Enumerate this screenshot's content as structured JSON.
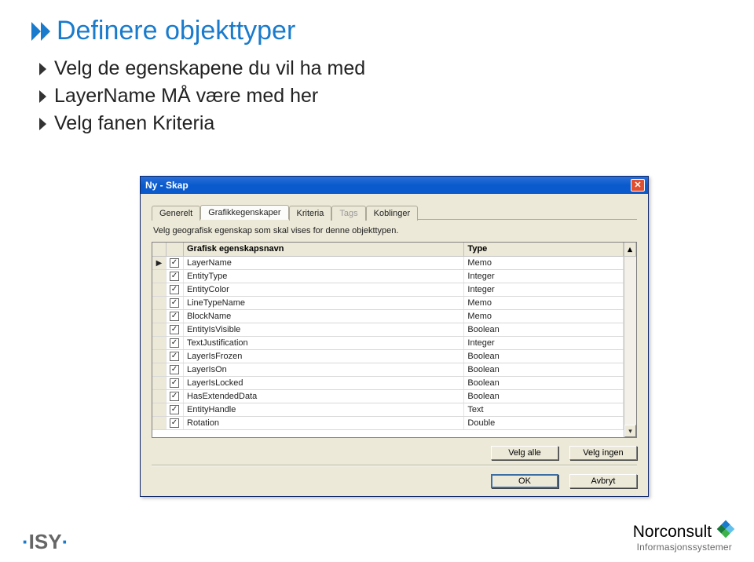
{
  "slide": {
    "title": "Definere objekttyper",
    "bullets": [
      "Velg de egenskapene du vil ha med",
      "LayerName MÅ være med her",
      "Velg fanen Kriteria"
    ]
  },
  "dialog": {
    "title": "Ny - Skap",
    "tabs": [
      {
        "label": "Generelt",
        "state": "normal"
      },
      {
        "label": "Grafikkegenskaper",
        "state": "active"
      },
      {
        "label": "Kriteria",
        "state": "normal"
      },
      {
        "label": "Tags",
        "state": "disabled"
      },
      {
        "label": "Koblinger",
        "state": "normal"
      }
    ],
    "instruction": "Velg geografisk egenskap som skal vises for denne objekttypen.",
    "grid": {
      "header_name": "Grafisk egenskapsnavn",
      "header_type": "Type",
      "rows": [
        {
          "mark": "▶",
          "checked": true,
          "name": "LayerName",
          "type": "Memo"
        },
        {
          "mark": "",
          "checked": true,
          "name": "EntityType",
          "type": "Integer"
        },
        {
          "mark": "",
          "checked": true,
          "name": "EntityColor",
          "type": "Integer"
        },
        {
          "mark": "",
          "checked": true,
          "name": "LineTypeName",
          "type": "Memo"
        },
        {
          "mark": "",
          "checked": true,
          "name": "BlockName",
          "type": "Memo"
        },
        {
          "mark": "",
          "checked": true,
          "name": "EntityIsVisible",
          "type": "Boolean"
        },
        {
          "mark": "",
          "checked": true,
          "name": "TextJustification",
          "type": "Integer"
        },
        {
          "mark": "",
          "checked": true,
          "name": "LayerIsFrozen",
          "type": "Boolean"
        },
        {
          "mark": "",
          "checked": true,
          "name": "LayerIsOn",
          "type": "Boolean"
        },
        {
          "mark": "",
          "checked": true,
          "name": "LayerIsLocked",
          "type": "Boolean"
        },
        {
          "mark": "",
          "checked": true,
          "name": "HasExtendedData",
          "type": "Boolean"
        },
        {
          "mark": "",
          "checked": true,
          "name": "EntityHandle",
          "type": "Text"
        },
        {
          "mark": "",
          "checked": true,
          "name": "Rotation",
          "type": "Double"
        }
      ]
    },
    "buttons": {
      "select_all": "Velg alle",
      "select_none": "Velg ingen",
      "ok": "OK",
      "cancel": "Avbryt"
    }
  },
  "footer": {
    "logo_isy": "·ISY·",
    "logo_nc_top": "Norconsult",
    "logo_nc_sub": "Informasjonssystemer"
  }
}
